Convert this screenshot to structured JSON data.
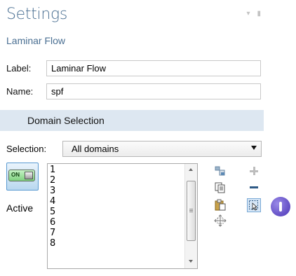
{
  "panel": {
    "title": "Settings",
    "subtitle": "Laminar Flow"
  },
  "fields": {
    "label_caption": "Label:",
    "label_value": "Laminar Flow",
    "name_caption": "Name:",
    "name_value": "spf"
  },
  "domain_selection": {
    "header": "Domain Selection",
    "selection_caption": "Selection:",
    "selection_value": "All domains",
    "active_toggle": "ON",
    "active_label": "Active",
    "items": [
      "1",
      "2",
      "3",
      "4",
      "5",
      "6",
      "7",
      "8"
    ]
  },
  "icons": {
    "pin": "pin-icon",
    "dropdown": "chevron-down-icon",
    "copy_selection": "copy-selection-icon",
    "paste_selection": "paste-selection-icon",
    "zoom_to_selection": "zoom-to-selection-icon",
    "add": "plus-icon",
    "remove": "minus-icon",
    "select_box": "select-box-icon",
    "badge": "step-marker-icon"
  },
  "colors": {
    "title": "#4a6f92",
    "section_header_bg": "#dde7f1",
    "badge": "#5a45c4",
    "remove_icon": "#2e5a86",
    "select_icon_bg": "#d6e6f6"
  }
}
